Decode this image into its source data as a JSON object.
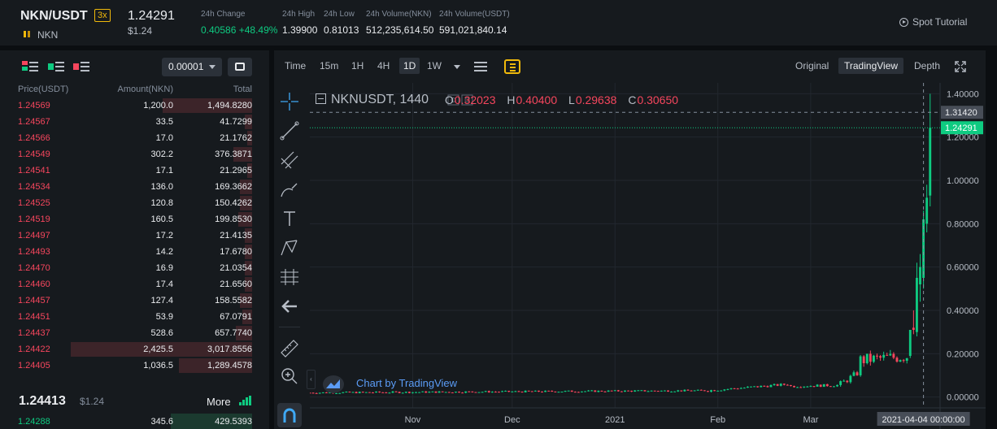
{
  "header": {
    "pair": "NKN/USDT",
    "leverage": "3x",
    "coin_name": "NKN",
    "last_price": "1.24291",
    "last_price_usd": "$1.24",
    "stats": [
      {
        "label": "24h Change",
        "value": "0.40586 +48.49%",
        "color": "#0ecb81"
      },
      {
        "label": "24h High",
        "value": "1.39900"
      },
      {
        "label": "24h Low",
        "value": "0.81013"
      },
      {
        "label": "24h Volume(NKN)",
        "value": "512,235,614.50"
      },
      {
        "label": "24h Volume(USDT)",
        "value": "591,021,840.14"
      }
    ],
    "spot_tutorial": "Spot Tutorial"
  },
  "orderbook": {
    "precision": "0.00001",
    "columns": [
      "Price(USDT)",
      "Amount(NKN)",
      "Total"
    ],
    "asks": [
      {
        "price": "1.24569",
        "amount": "1,200.0",
        "total": "1,494.8280",
        "depth": 0.38
      },
      {
        "price": "1.24567",
        "amount": "33.5",
        "total": "41.7299",
        "depth": 0.03
      },
      {
        "price": "1.24566",
        "amount": "17.0",
        "total": "21.1762",
        "depth": 0.02
      },
      {
        "price": "1.24549",
        "amount": "302.2",
        "total": "376.3871",
        "depth": 0.08
      },
      {
        "price": "1.24541",
        "amount": "17.1",
        "total": "21.2965",
        "depth": 0.02
      },
      {
        "price": "1.24534",
        "amount": "136.0",
        "total": "169.3662",
        "depth": 0.05
      },
      {
        "price": "1.24525",
        "amount": "120.8",
        "total": "150.4262",
        "depth": 0.05
      },
      {
        "price": "1.24519",
        "amount": "160.5",
        "total": "199.8530",
        "depth": 0.06
      },
      {
        "price": "1.24497",
        "amount": "17.2",
        "total": "21.4135",
        "depth": 0.03
      },
      {
        "price": "1.24493",
        "amount": "14.2",
        "total": "17.6780",
        "depth": 0.03
      },
      {
        "price": "1.24470",
        "amount": "16.9",
        "total": "21.0354",
        "depth": 0.03
      },
      {
        "price": "1.24460",
        "amount": "17.4",
        "total": "21.6560",
        "depth": 0.03
      },
      {
        "price": "1.24457",
        "amount": "127.4",
        "total": "158.5582",
        "depth": 0.05
      },
      {
        "price": "1.24451",
        "amount": "53.9",
        "total": "67.0791",
        "depth": 0.04
      },
      {
        "price": "1.24437",
        "amount": "528.6",
        "total": "657.7740",
        "depth": 0.07
      },
      {
        "price": "1.24422",
        "amount": "2,425.5",
        "total": "3,017.8556",
        "depth": 0.77
      },
      {
        "price": "1.24405",
        "amount": "1,036.5",
        "total": "1,289.4578",
        "depth": 0.31
      }
    ],
    "mid_price": "1.24413",
    "mid_price_usd": "$1.24",
    "more": "More",
    "bid": {
      "price": "1.24288",
      "amount": "345.6",
      "total": "429.5393"
    }
  },
  "chart_toolbar": {
    "intervals": [
      "Time",
      "15m",
      "1H",
      "4H",
      "1D",
      "1W"
    ],
    "active_interval": "1D",
    "views": [
      "Original",
      "TradingView",
      "Depth"
    ],
    "active_view": "TradingView"
  },
  "chart": {
    "symbol": "NKNUSDT, 1440",
    "ohlc": {
      "O": "0.32023",
      "H": "0.40400",
      "L": "0.29638",
      "C": "0.30650"
    },
    "crosshair_price": "1.31420",
    "crosshair_date": "2021-04-04 00:00:00",
    "last_price_label": "1.24291",
    "watermark": "Chart by TradingView"
  },
  "chart_data": {
    "type": "candlestick",
    "y_ticks": [
      "1.40000",
      "1.20000",
      "1.00000",
      "0.80000",
      "0.60000",
      "0.40000",
      "0.20000",
      "0.00000"
    ],
    "y_tick_values": [
      1.4,
      1.2,
      1.0,
      0.8,
      0.6,
      0.4,
      0.2,
      0.0
    ],
    "ylim": [
      -0.05,
      1.45
    ],
    "x_ticks": [
      "Nov",
      "Dec",
      "2021",
      "Feb",
      "Mar"
    ],
    "x_tick_days": [
      31,
      61,
      92,
      123,
      151
    ],
    "x_range_days": [
      0,
      190
    ],
    "up_color": "#0ecb81",
    "down_color": "#f6465d",
    "crosshair": {
      "day": 185,
      "price": 1.3142
    },
    "last_price": 1.24291,
    "segments": [
      {
        "from_day": 0,
        "to_day": 120,
        "start": 0.02,
        "end": 0.03,
        "wiggle": 0.004
      },
      {
        "from_day": 120,
        "to_day": 145,
        "start": 0.03,
        "end": 0.06,
        "wiggle": 0.006
      },
      {
        "from_day": 145,
        "to_day": 160,
        "start": 0.05,
        "end": 0.055,
        "wiggle": 0.006
      },
      {
        "from_day": 160,
        "to_day": 166,
        "start": 0.06,
        "end": 0.12,
        "wiggle": 0.015
      },
      {
        "from_day": 166,
        "to_day": 181,
        "start": 0.17,
        "end": 0.19,
        "wiggle": 0.03
      }
    ],
    "tail_candles": [
      {
        "o": 0.19,
        "h": 0.3,
        "l": 0.18,
        "c": 0.31
      },
      {
        "o": 0.32,
        "h": 0.4,
        "l": 0.29,
        "c": 0.31
      },
      {
        "o": 0.3,
        "h": 0.62,
        "l": 0.28,
        "c": 0.55
      },
      {
        "o": 0.52,
        "h": 0.66,
        "l": 0.44,
        "c": 0.6
      },
      {
        "o": 0.55,
        "h": 0.86,
        "l": 0.5,
        "c": 0.82
      },
      {
        "o": 0.8,
        "h": 0.98,
        "l": 0.76,
        "c": 0.92
      },
      {
        "o": 0.93,
        "h": 1.4,
        "l": 0.88,
        "c": 1.2429
      }
    ]
  }
}
